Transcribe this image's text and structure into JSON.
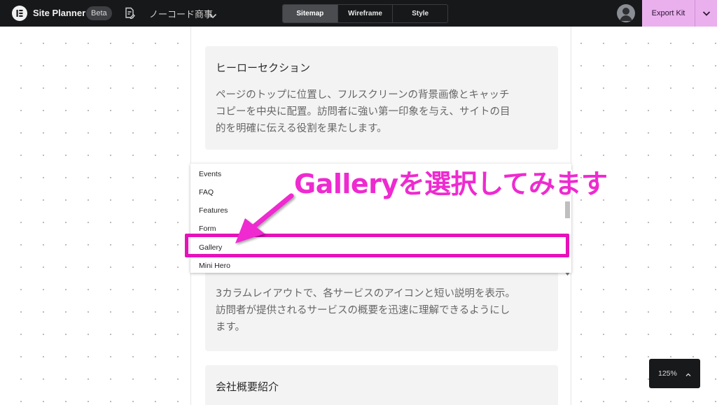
{
  "header": {
    "app_title": "Site Planner",
    "badge": "Beta",
    "project_name": "ノーコード商事",
    "tabs": [
      {
        "label": "Sitemap",
        "active": true
      },
      {
        "label": "Wireframe",
        "active": false
      },
      {
        "label": "Style",
        "active": false
      }
    ],
    "export_label": "Export Kit",
    "icons": {
      "logo": "elementor-logo-icon",
      "project": "document-edit-icon",
      "project_menu": "chevron-down-icon",
      "avatar": "user-avatar-icon",
      "export_menu": "chevron-down-icon"
    }
  },
  "page": {
    "cards": [
      {
        "title": "ヒーローセクション",
        "body_lines": [
          "ページのトップに位置し、フルスクリーンの背景画像とキャッチ",
          "コピーを中央に配置。訪問者に強い第一印象を与え、サイトの目",
          "的を明確に伝える役割を果たします。"
        ]
      },
      {
        "title": "",
        "body_lines": [
          "3カラムレイアウトで、各サービスのアイコンと短い説明を表示。",
          "訪問者が提供されるサービスの概要を迅速に理解できるようにし",
          "ます。"
        ]
      },
      {
        "title": "会社概要紹介",
        "body_lines": []
      }
    ]
  },
  "dropdown": {
    "options": [
      "Events",
      "FAQ",
      "Features",
      "Form",
      "Gallery",
      "Mini Hero"
    ],
    "highlighted": "Gallery"
  },
  "annotation": {
    "callout": "Galleryを選択してみます",
    "color": "#ee2ad0"
  },
  "zoom": {
    "level": "125%",
    "icon": "chevron-up-icon"
  },
  "colors": {
    "topbar": "#17181a",
    "export": "#eab0ee",
    "highlight": "#e612b8"
  }
}
